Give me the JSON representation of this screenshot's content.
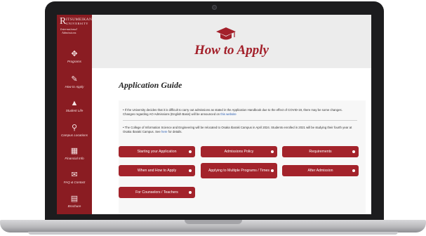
{
  "sidebar": {
    "logo_letter": "R",
    "brand_line1": "ITSUMEIKAN",
    "brand_line2": "UNIVERSITY",
    "brand_line3": "International",
    "brand_line4": "Admissions",
    "items": [
      {
        "label": "Programs",
        "icon": "programs-icon"
      },
      {
        "label": "How to Apply",
        "icon": "document-icon"
      },
      {
        "label": "Student Life",
        "icon": "graduation-cap-icon"
      },
      {
        "label": "Campus Locations",
        "icon": "map-pin-icon"
      },
      {
        "label": "Financial Info",
        "icon": "calculator-icon"
      },
      {
        "label": "FAQ & Contact",
        "icon": "faq-icon"
      },
      {
        "label": "Brochure",
        "icon": "brochure-icon"
      }
    ]
  },
  "hero": {
    "title": "How to Apply",
    "icon": "graduation-cap-icon"
  },
  "section": {
    "title": "Application Guide"
  },
  "notes": {
    "note1": "• If the University decides that it is difficult to carry out admissions as stated in the Application Handbook due to the effect of COVID-19, there may be some changes.",
    "note1b": "Changes regarding AO Admissions (English Basis) will be announced on",
    "note1_link": "this website",
    "note2": "• The College of Information Science and Engineering will be relocated to Osaka Ibaraki Campus in April 2024. Students enrolled in 2021 will be studying their fourth year at Osaka Ibaraki Campus. See",
    "note2_link": "here",
    "note2_end": "for details."
  },
  "buttons": [
    "Starting your Application",
    "Admissions Policy",
    "Requirements",
    "When and How to Apply",
    "Applying to Multiple Programs / Times",
    "After Admission",
    "For Counselors / Teachers"
  ],
  "colors": {
    "brand": "#8a1c22",
    "accent": "#a3232b"
  }
}
